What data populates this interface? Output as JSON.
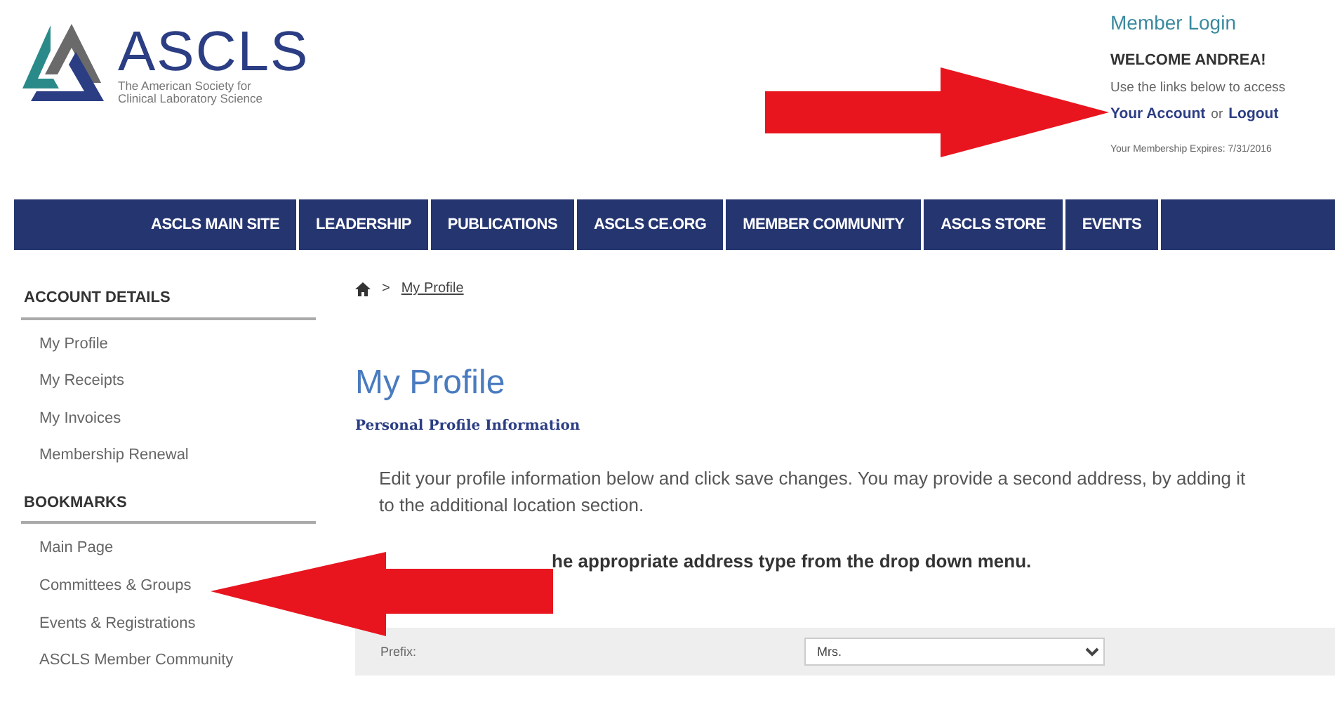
{
  "logo": {
    "name": "ASCLS",
    "tagline": "The American Society for Clinical Laboratory Science"
  },
  "member_panel": {
    "title": "Member Login",
    "welcome": "WELCOME ANDREA!",
    "hint": "Use the links below to access",
    "account_link": "Your Account",
    "separator": "or",
    "logout_link": "Logout",
    "expires": "Your Membership Expires: 7/31/2016"
  },
  "nav": [
    "ASCLS MAIN SITE",
    "LEADERSHIP",
    "PUBLICATIONS",
    "ASCLS CE.ORG",
    "MEMBER COMMUNITY",
    "ASCLS STORE",
    "EVENTS"
  ],
  "sidebar": [
    {
      "heading": "ACCOUNT DETAILS",
      "items": [
        "My Profile",
        "My Receipts",
        "My Invoices",
        "Membership Renewal"
      ]
    },
    {
      "heading": "BOOKMARKS",
      "items": [
        "Main Page",
        "Committees & Groups",
        "Events & Registrations",
        "ASCLS Member Community"
      ]
    }
  ],
  "breadcrumb": {
    "separator": ">",
    "current": "My Profile"
  },
  "page_title": "My Profile",
  "section_title": "Personal Profile Information",
  "intro": "Edit your profile information below and click save changes. You may provide a second address, by adding it to the additional location section.",
  "instruction": "he appropriate address type from the drop down menu.",
  "form": [
    {
      "label": "Prefix:",
      "value": "Mrs."
    }
  ]
}
